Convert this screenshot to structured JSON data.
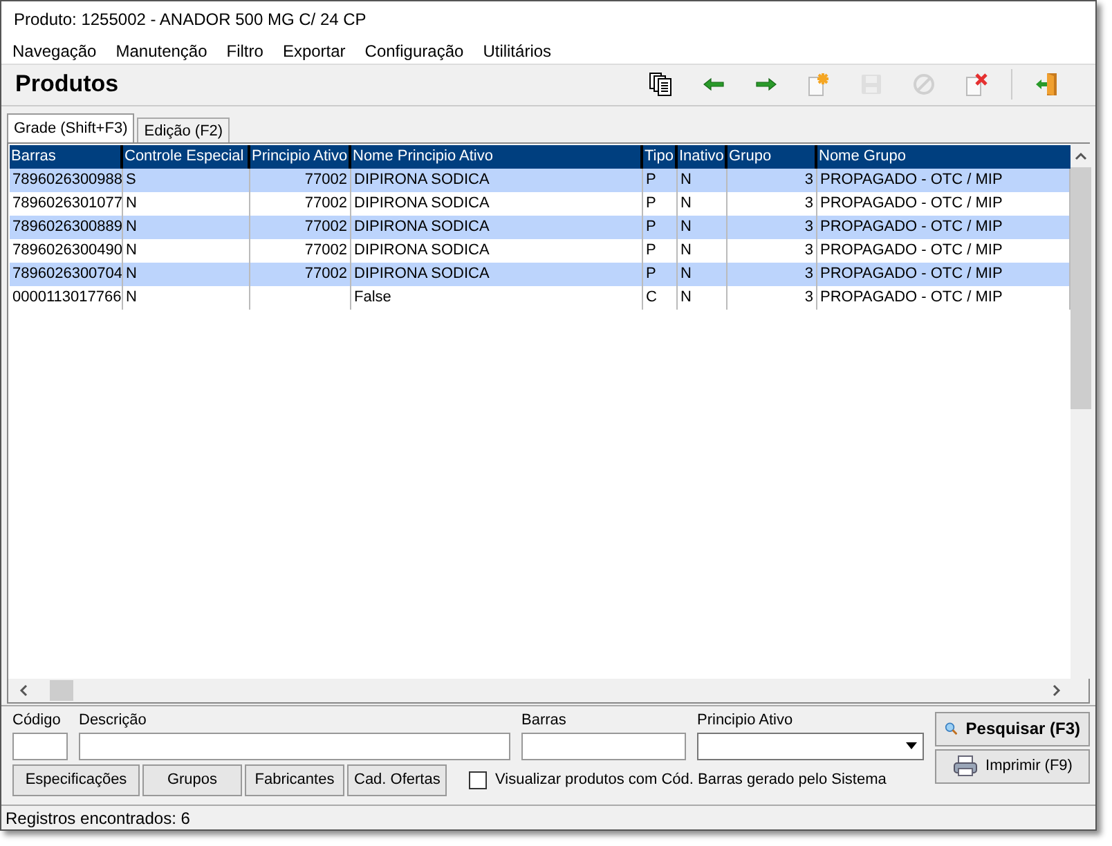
{
  "window": {
    "title": "Produto: 1255002 - ANADOR 500 MG C/ 24 CP"
  },
  "menu": [
    "Navegação",
    "Manutenção",
    "Filtro",
    "Exportar",
    "Configuração",
    "Utilitários"
  ],
  "header": {
    "title": "Produtos"
  },
  "toolbar": [
    {
      "kind": "copy",
      "disabled": false
    },
    {
      "kind": "back",
      "disabled": false
    },
    {
      "kind": "forward",
      "disabled": false
    },
    {
      "kind": "new",
      "disabled": false
    },
    {
      "kind": "save",
      "disabled": true
    },
    {
      "kind": "cancel",
      "disabled": true
    },
    {
      "kind": "delete",
      "disabled": false
    },
    {
      "kind": "exit",
      "disabled": false
    }
  ],
  "tabs": [
    {
      "label": "Grade (Shift+F3)",
      "selected": true
    },
    {
      "label": "Edição (F2)",
      "selected": false
    }
  ],
  "table": {
    "columns": [
      "Barras",
      "Controle Especial",
      "Principio Ativo",
      "Nome Principio Ativo",
      "Tipo",
      "Inativo",
      "Grupo",
      "Nome Grupo"
    ],
    "rows": [
      [
        "7896026300988",
        "S",
        "77002",
        "DIPIRONA SODICA",
        "P",
        "N",
        "3",
        "PROPAGADO - OTC / MIP"
      ],
      [
        "7896026301077",
        "N",
        "77002",
        "DIPIRONA SODICA",
        "P",
        "N",
        "3",
        "PROPAGADO - OTC / MIP"
      ],
      [
        "7896026300889",
        "N",
        "77002",
        "DIPIRONA SODICA",
        "P",
        "N",
        "3",
        "PROPAGADO - OTC / MIP"
      ],
      [
        "7896026300490",
        "N",
        "77002",
        "DIPIRONA SODICA",
        "P",
        "N",
        "3",
        "PROPAGADO - OTC / MIP"
      ],
      [
        "7896026300704",
        "N",
        "77002",
        "DIPIRONA SODICA",
        "P",
        "N",
        "3",
        "PROPAGADO - OTC / MIP"
      ],
      [
        "0000113017766",
        "N",
        "",
        "False",
        "C",
        "N",
        "3",
        "PROPAGADO - OTC / MIP"
      ]
    ]
  },
  "filters": {
    "codigo": {
      "label": "Código"
    },
    "descricao": {
      "label": "Descrição"
    },
    "barras": {
      "label": "Barras"
    },
    "principio": {
      "label": "Principio Ativo"
    }
  },
  "buttons": [
    "Especificações",
    "Grupos",
    "Fabricantes",
    "Cad. Ofertas"
  ],
  "checkbox": {
    "label": "Visualizar produtos com Cód. Barras gerado pelo Sistema",
    "checked": false
  },
  "search_button": "Pesquisar (F3)",
  "print_button": "Imprimir (F9)",
  "status_bar": "Registros encontrados: 6"
}
